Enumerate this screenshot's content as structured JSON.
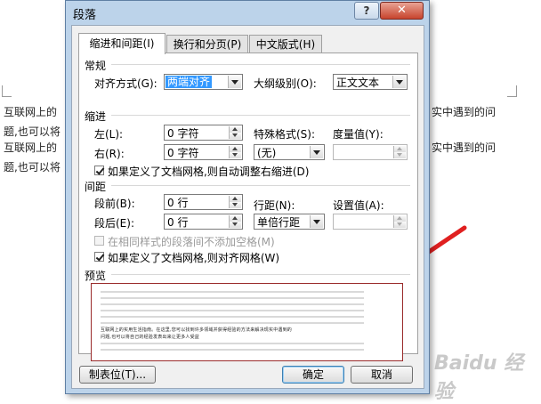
{
  "background": {
    "lines": [
      {
        "left": "互联网上的",
        "right": "实中遇到的问"
      },
      {
        "left": "题,也可以将",
        "right": ""
      },
      {
        "left": "互联网上的",
        "right": "实中遇到的问"
      },
      {
        "left": "题,也可以将",
        "right": ""
      }
    ],
    "watermark": "Baidu 经验"
  },
  "dialog": {
    "title": "段落",
    "help_glyph": "?",
    "close_glyph": "✕",
    "tabs": [
      {
        "label": "缩进和间距(I)",
        "active": true
      },
      {
        "label": "换行和分页(P)",
        "active": false
      },
      {
        "label": "中文版式(H)",
        "active": false
      }
    ],
    "general": {
      "section_label": "常规",
      "alignment_label": "对齐方式(G):",
      "alignment_value": "两端对齐",
      "outline_label": "大纲级别(O):",
      "outline_value": "正文文本"
    },
    "indent": {
      "section_label": "缩进",
      "left_label": "左(L):",
      "left_value": "0 字符",
      "right_label": "右(R):",
      "right_value": "0 字符",
      "special_label": "特殊格式(S):",
      "special_value": "(无)",
      "by_label": "度量值(Y):",
      "by_value": "",
      "auto_adjust_label": "如果定义了文档网格,则自动调整右缩进(D)",
      "auto_adjust_checked": true
    },
    "spacing": {
      "section_label": "间距",
      "before_label": "段前(B):",
      "before_value": "0 行",
      "after_label": "段后(E):",
      "after_value": "0 行",
      "line_label": "行距(N):",
      "line_value": "单倍行距",
      "at_label": "设置值(A):",
      "at_value": "",
      "no_space_label": "在相同样式的段落间不添加空格(M)",
      "no_space_checked": false,
      "snap_grid_label": "如果定义了文档网格,则对齐网格(W)",
      "snap_grid_checked": true
    },
    "preview": {
      "section_label": "预览",
      "sample_text_1": "互联网上的实用生活指南。在这里,您可以找到许多领域并获得经验的方法来解决现实中遇到的",
      "sample_text_2": "问题,也可以将自己的经验发表出来让更多人受益"
    },
    "buttons": {
      "tabs_label": "制表位(T)...",
      "ok_label": "确定",
      "cancel_label": "取消"
    }
  },
  "colors": {
    "frame": "#bcd3ea",
    "close": "#c7442d",
    "highlight": "#3399ff",
    "annotation": "#e02020"
  }
}
